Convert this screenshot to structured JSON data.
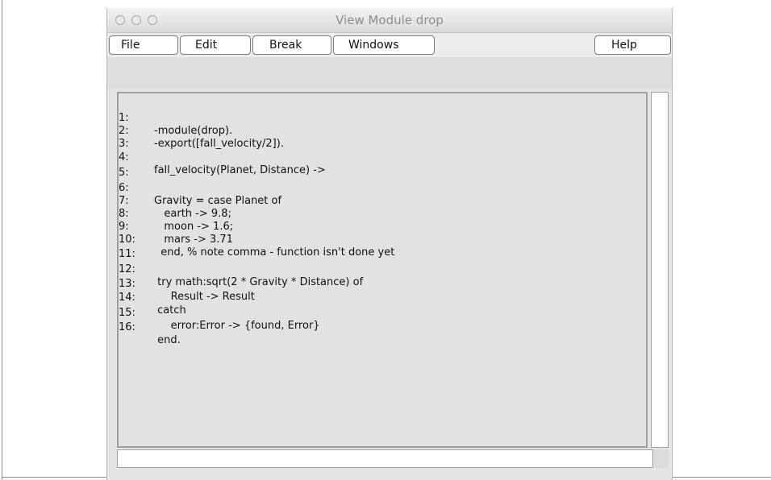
{
  "window": {
    "title": "View Module drop"
  },
  "menu": {
    "file": "File",
    "edit": "Edit",
    "break": "Break",
    "windows": "Windows",
    "help": "Help"
  },
  "code": {
    "lines": [
      {
        "num": "1:",
        "text": "-module(drop)."
      },
      {
        "num": "2:",
        "text": "-export([fall_velocity/2])."
      },
      {
        "num": "3:",
        "text": ""
      },
      {
        "num": "4:",
        "text": "fall_velocity(Planet, Distance) ->"
      },
      {
        "num": "5:",
        "text": ""
      },
      {
        "num": "6:",
        "text": "Gravity = case Planet of"
      },
      {
        "num": "7:",
        "text": "   earth -> 9.8;"
      },
      {
        "num": "8:",
        "text": "   moon -> 1.6;"
      },
      {
        "num": "9:",
        "text": "   mars -> 3.71"
      },
      {
        "num": "10:",
        "text": "  end, % note comma - function isn't done yet"
      },
      {
        "num": "11:",
        "text": ""
      },
      {
        "num": "12:",
        "text": " try math:sqrt(2 * Gravity * Distance) of"
      },
      {
        "num": "13:",
        "text": "     Result -> Result"
      },
      {
        "num": "14:",
        "text": " catch"
      },
      {
        "num": "15:",
        "text": "     error:Error -> {found, Error}"
      },
      {
        "num": "16:",
        "text": " end."
      }
    ]
  },
  "input": {
    "value": ""
  },
  "colors": {
    "window_bg": "#e5e5e5",
    "editor_bg": "#e2e2e2"
  }
}
